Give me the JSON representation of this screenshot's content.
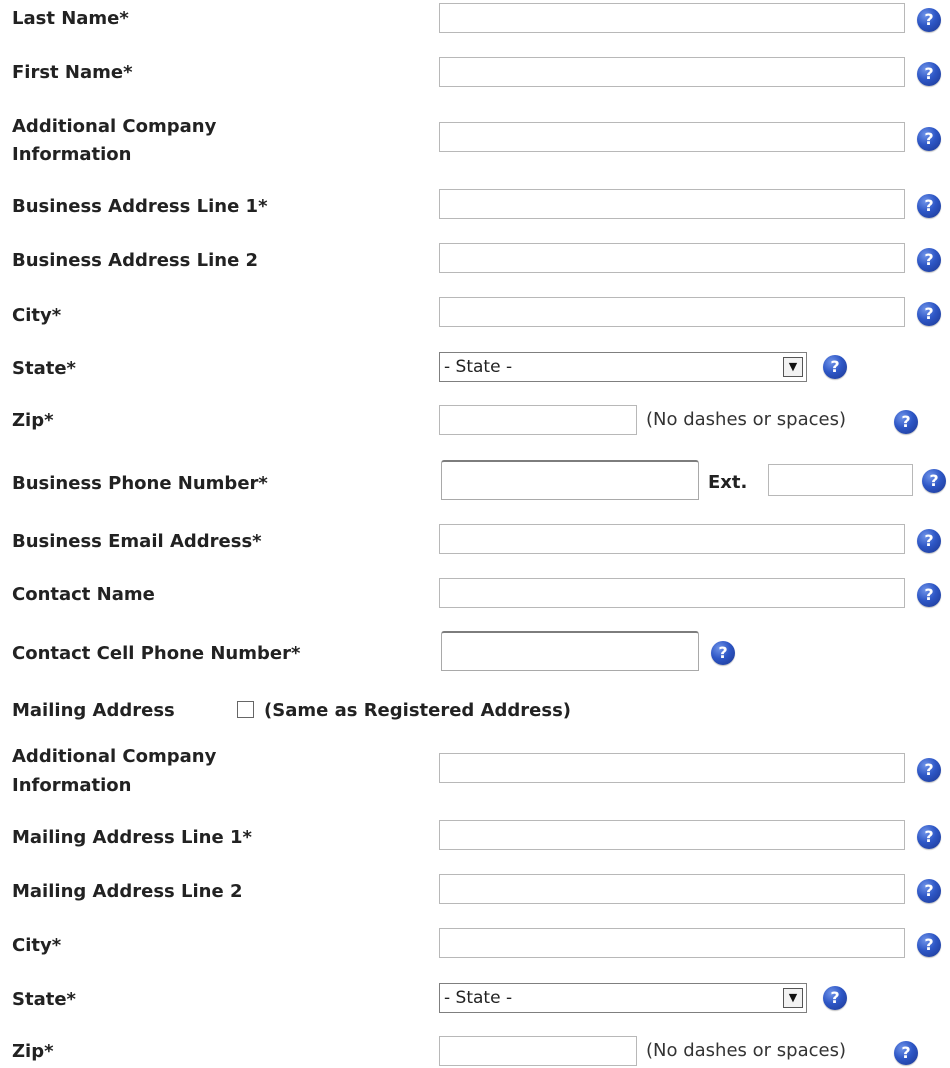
{
  "business_section": {
    "last_name_label": "Last Name*",
    "first_name_label": "First Name*",
    "additional_info_label_line1": "Additional Company",
    "additional_info_label_line2": "Information",
    "address_line1_label": "Business Address Line 1*",
    "address_line2_label": "Business Address Line 2",
    "city_label": "City*",
    "state_label": "State*",
    "state_selected": "- State -",
    "zip_label": "Zip*",
    "zip_note": "(No dashes or spaces)",
    "phone_label": "Business Phone Number*",
    "ext_label": "Ext.",
    "email_label": "Business Email Address*",
    "contact_name_label": "Contact Name",
    "contact_cell_label": "Contact Cell Phone Number*"
  },
  "mailing_section": {
    "mailing_address_label": "Mailing Address",
    "same_as_label": "(Same as Registered Address)",
    "additional_info_label_line1": "Additional Company",
    "additional_info_label_line2": "Information",
    "address_line1_label": "Mailing Address Line 1*",
    "address_line2_label": "Mailing Address Line 2",
    "city_label": "City*",
    "state_label": "State*",
    "state_selected": "- State -",
    "zip_label": "Zip*",
    "zip_note": "(No dashes or spaces)"
  },
  "icons": {
    "help": "question-mark-icon",
    "dropdown": "chevron-down-icon"
  },
  "help_glyph": "?",
  "dropdown_glyph": "▼",
  "colors": {
    "help_icon": "#2e57c6",
    "input_border": "#b8b8b8",
    "label_text": "#222222"
  }
}
